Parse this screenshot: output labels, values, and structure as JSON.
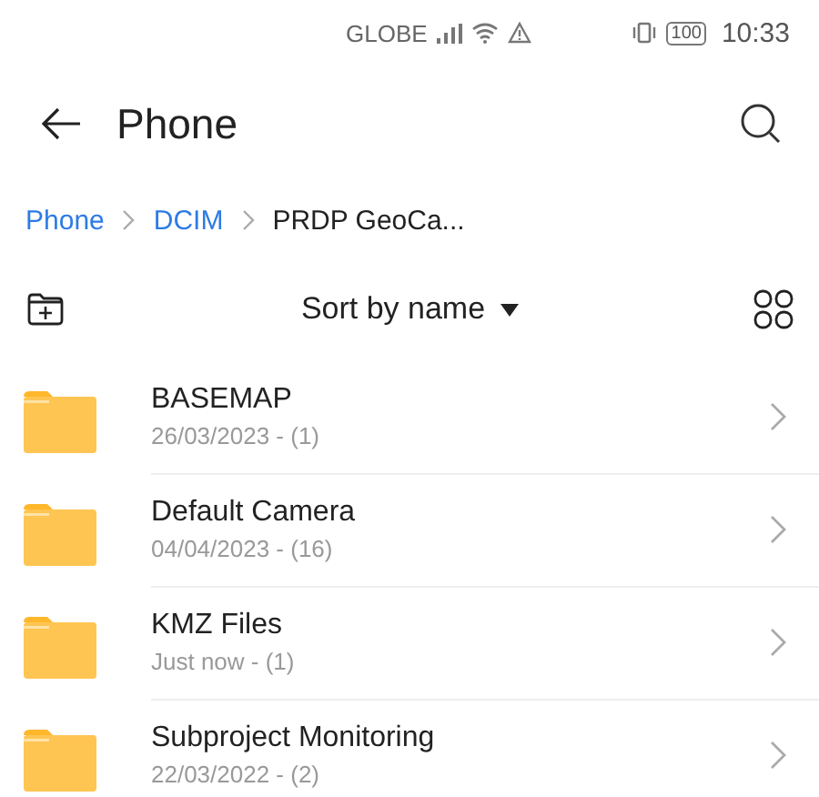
{
  "status_bar": {
    "carrier": "GLOBE",
    "battery": "100",
    "time": "10:33"
  },
  "header": {
    "title": "Phone"
  },
  "breadcrumb": [
    {
      "label": "Phone",
      "kind": "link"
    },
    {
      "label": "DCIM",
      "kind": "link"
    },
    {
      "label": "PRDP GeoCa...",
      "kind": "current"
    }
  ],
  "toolbar": {
    "sort": "Sort by name"
  },
  "folders": [
    {
      "name": "BASEMAP",
      "meta": "26/03/2023 - (1)"
    },
    {
      "name": "Default Camera",
      "meta": "04/04/2023 - (16)"
    },
    {
      "name": "KMZ Files",
      "meta": "Just now - (1)"
    },
    {
      "name": "Subproject Monitoring",
      "meta": "22/03/2022 - (2)"
    }
  ]
}
